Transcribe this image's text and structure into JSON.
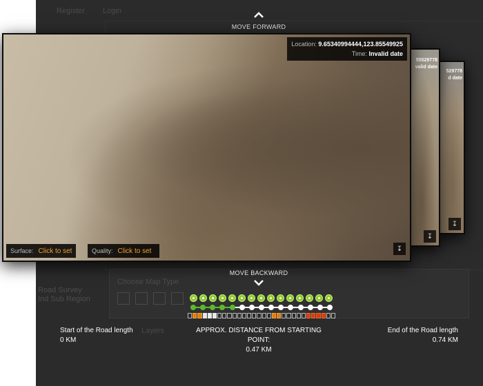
{
  "background": {
    "nav": [
      "Register",
      "Login"
    ],
    "choose_map_type": "Choose Map Type",
    "side_text_1": "Road Survey",
    "side_text_2": "Ind Sub Region",
    "layers": "Layers"
  },
  "navigation": {
    "forward_label": "MOVE FORWARD",
    "backward_label": "MOVE BACKWARD"
  },
  "photo_main": {
    "location_label": "Location:",
    "location_value": "9.65340994444,123.85549925",
    "time_label": "Time:",
    "time_value": "Invalid date",
    "surface_label": "Surface:",
    "surface_action": "Click to set",
    "quality_label": "Quality:",
    "quality_action": "Click to set"
  },
  "photo_back_1": {
    "coord_fragment": "55529778",
    "time_fragment": "valid date"
  },
  "photo_back_2": {
    "coord_fragment": "529778",
    "time_fragment": "d date"
  },
  "road_slider": {
    "circle_count": 15,
    "dot_count": 15,
    "current_index": 4,
    "segments": [
      "b",
      "o",
      "o",
      "w",
      "w",
      "w",
      "b",
      "b",
      "b",
      "b",
      "b",
      "b",
      "b",
      "b",
      "b",
      "b",
      "b",
      "o",
      "o",
      "b",
      "b",
      "b",
      "b",
      "b",
      "r",
      "r",
      "r",
      "r",
      "b",
      "b"
    ],
    "colors": {
      "green": "#8ecb2f",
      "orange": "#e07a10",
      "red": "#d43c10"
    }
  },
  "road": {
    "start_label": "Start of the Road length",
    "start_value": "0 KM",
    "distance_label": "APPROX. DISTANCE FROM STARTING POINT:",
    "distance_value": "0.47 KM",
    "end_label": "End of the Road length",
    "end_value": "0.74 KM"
  }
}
